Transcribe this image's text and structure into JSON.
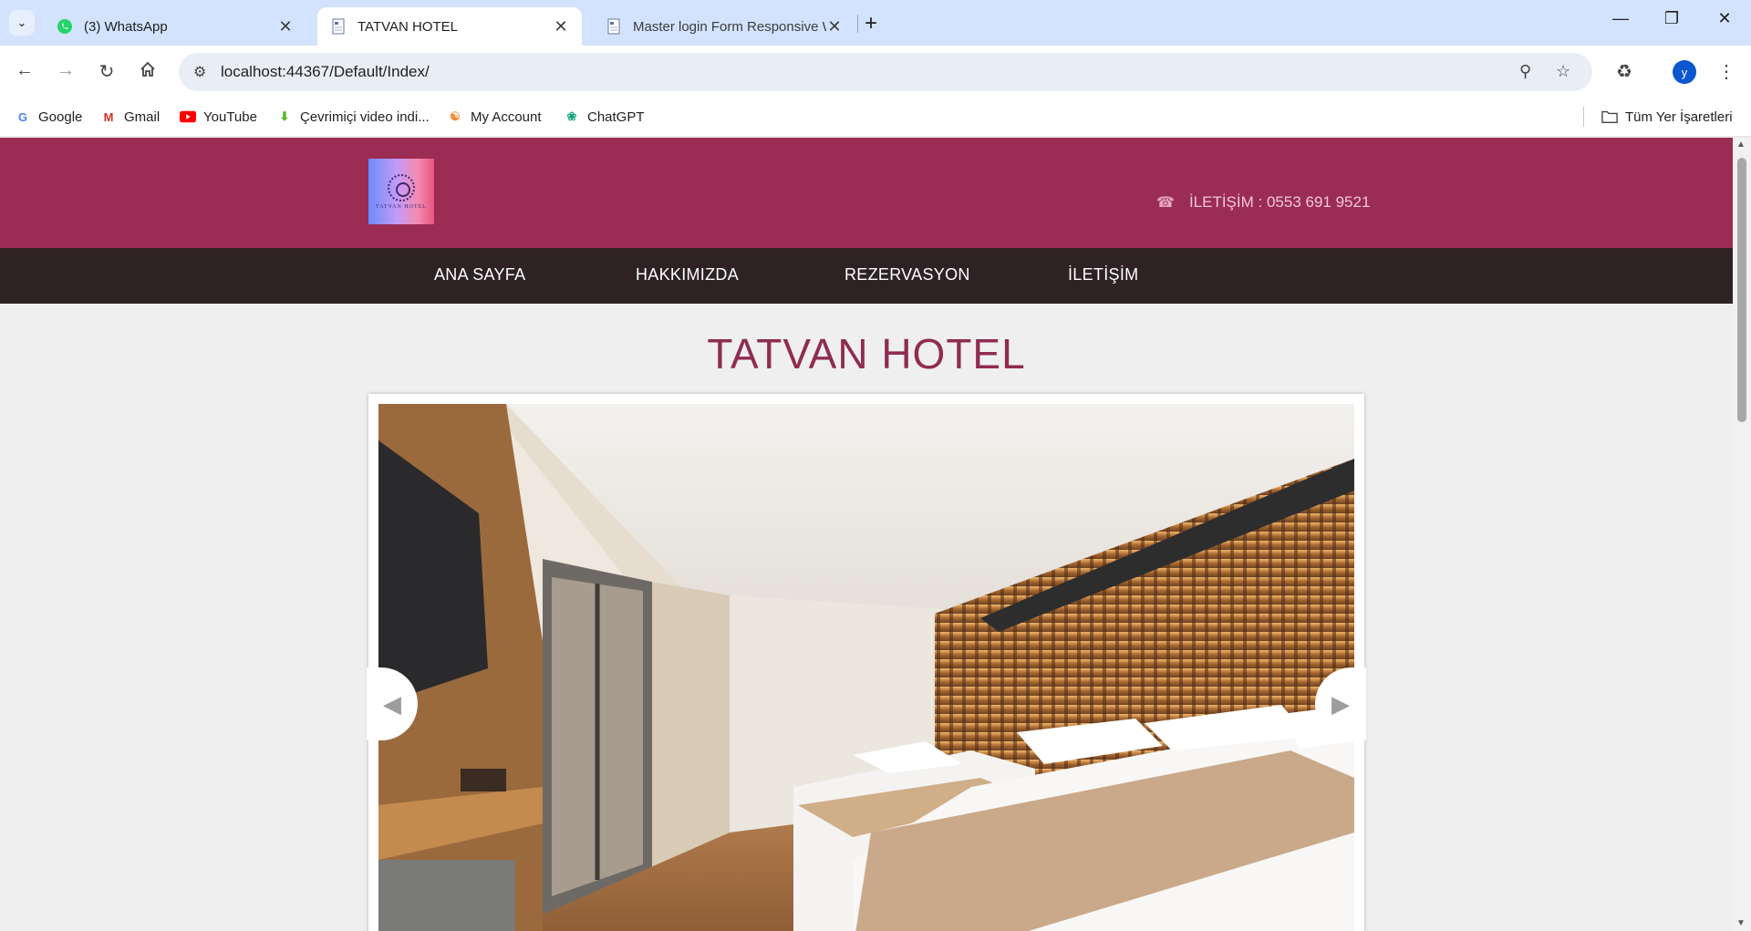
{
  "browser": {
    "tabs": [
      {
        "title": "(3) WhatsApp",
        "active": false,
        "icon": "whatsapp-icon"
      },
      {
        "title": "TATVAN HOTEL",
        "active": true,
        "icon": "page-icon"
      },
      {
        "title": "Master login Form Responsive W",
        "active": false,
        "icon": "page-icon"
      }
    ],
    "url": "localhost:44367/Default/Index/",
    "profile_initial": "y",
    "bookmarks": [
      {
        "label": "Google",
        "icon": "google-icon"
      },
      {
        "label": "Gmail",
        "icon": "gmail-icon"
      },
      {
        "label": "YouTube",
        "icon": "youtube-icon"
      },
      {
        "label": "Çevrimiçi video indi...",
        "icon": "download-icon"
      },
      {
        "label": "My Account",
        "icon": "account-icon"
      },
      {
        "label": "ChatGPT",
        "icon": "chatgpt-icon"
      }
    ],
    "all_bookmarks": "Tüm Yer İşaretleri"
  },
  "site": {
    "logo_text": "TATVAN HOTEL",
    "contact": "İLETİŞİM : 0553 691 9521",
    "nav": [
      "ANA SAYFA",
      "HAKKIMIZDA",
      "REZERVASYON",
      "İLETİŞİM"
    ],
    "title": "TATVAN HOTEL"
  },
  "colors": {
    "header": "#9b2c54",
    "nav": "#2e2224",
    "title": "#8f2c52",
    "browser_tabstrip": "#d3e3fd"
  }
}
